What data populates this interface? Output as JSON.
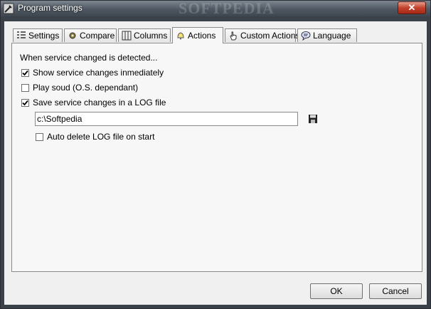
{
  "window": {
    "title": "Program settings",
    "watermark": "SOFTPEDIA",
    "close_label": "✕"
  },
  "tabs": [
    {
      "label": "Settings",
      "icon": "list-settings-icon"
    },
    {
      "label": "Compare",
      "icon": "gear-icon"
    },
    {
      "label": "Columns",
      "icon": "columns-icon"
    },
    {
      "label": "Actions",
      "icon": "bell-icon",
      "active": true
    },
    {
      "label": "Custom Actions",
      "icon": "hand-pointer-icon"
    },
    {
      "label": "Language",
      "icon": "speech-bubble-icon"
    }
  ],
  "actions": {
    "heading": "When service changed is detected...",
    "show_changes": {
      "label": "Show service changes inmediately",
      "checked": true
    },
    "play_sound": {
      "label": "Play soud (O.S. dependant)",
      "checked": false
    },
    "save_log": {
      "label": "Save service changes in a LOG file",
      "checked": true
    },
    "log_path": "c:\\Softpedia",
    "auto_delete": {
      "label": "Auto delete LOG file on start",
      "checked": false
    }
  },
  "buttons": {
    "ok": "OK",
    "cancel": "Cancel"
  },
  "colors": {
    "titlebar": "#4f5862",
    "close": "#c4412c",
    "client": "#f0f0f0"
  }
}
